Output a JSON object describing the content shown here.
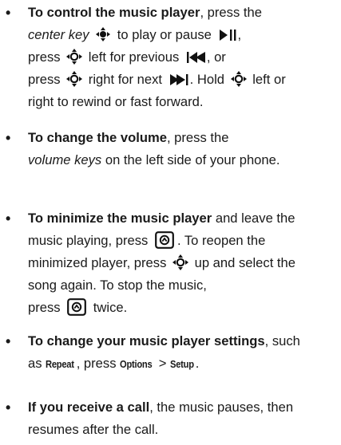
{
  "items": [
    {
      "lines": [
        {
          "bold": "To control the music player",
          "text": ", press the"
        },
        {
          "italic": "center key",
          "text_a": " to play or pause "
        },
        {
          "text_a": "press ",
          "text_b": " left for previous ",
          "text_c": ", or"
        },
        {
          "text_a": "press ",
          "text_b": " right for next ",
          "text_c": ". Hold ",
          "text_d": " left or"
        },
        {
          "text": "right to rewind or fast forward."
        }
      ]
    },
    {
      "lines": [
        {
          "bold": "To change the volume",
          "text": ", press the"
        },
        {
          "italic": "volume keys",
          "text": " on the left side of your phone."
        }
      ]
    },
    {
      "lines": [
        {
          "bold": "To minimize the music player",
          "text": " and leave the"
        },
        {
          "text_a": "music playing, press ",
          "text_b": ". To reopen the"
        },
        {
          "text_a": "minimized player, press ",
          "text_b": " up and select the"
        },
        {
          "text": "song again. To stop the music,"
        },
        {
          "text_a": "press ",
          "text_b": " twice."
        }
      ]
    },
    {
      "lines": [
        {
          "bold": "To change your music player settings",
          "text": ", such"
        },
        {
          "text_a": "as ",
          "menu_a": "Repeat",
          "text_b": ", press ",
          "menu_b": "Options",
          "text_c": " > ",
          "menu_c": "Setup",
          "text_d": "."
        }
      ]
    },
    {
      "lines": [
        {
          "bold": "If you receive a call",
          "text": ", the music pauses, then"
        },
        {
          "text": "resumes after the call."
        }
      ]
    }
  ],
  "bullet_char": "•",
  "icons": {
    "nav": "navigation-key-icon",
    "nav_center": "navigation-key-center-icon",
    "play_pause": "play-pause-icon",
    "previous": "previous-track-icon",
    "next": "next-track-icon",
    "end": "end-key-icon"
  },
  "colors": {
    "text": "#1a1a1a"
  }
}
